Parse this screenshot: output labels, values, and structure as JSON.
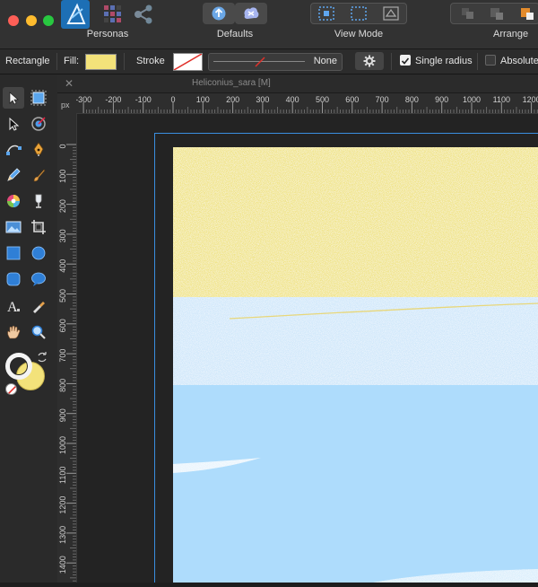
{
  "toolbar": {
    "personas_label": "Personas",
    "defaults_label": "Defaults",
    "view_mode_label": "View Mode",
    "arrange_label": "Arrange"
  },
  "context": {
    "tool_name": "Rectangle",
    "fill_label": "Fill:",
    "stroke_label": "Stroke",
    "stroke_value": "None",
    "single_radius_label": "Single radius",
    "single_radius_checked": true,
    "absolute_label": "Absolute",
    "fill_color": "#f3e27a"
  },
  "document": {
    "tab_title": "Heliconius_sara [M]",
    "ruler_unit": "px",
    "h_ticks": [
      "-300",
      "-200",
      "-100",
      "0",
      "100",
      "200",
      "300",
      "400",
      "500",
      "600",
      "700",
      "800",
      "900",
      "1000",
      "1100",
      "1200"
    ],
    "v_ticks": [
      "0",
      "100",
      "200",
      "300",
      "400",
      "500",
      "600",
      "700",
      "800",
      "900",
      "1000",
      "1100",
      "1200",
      "1300",
      "1400"
    ]
  },
  "colors": {
    "yellow_band": "#efe27c",
    "pale_blue_band": "#cde6fa",
    "blue_band": "#aedcfc",
    "selection": "#3a8fe0"
  },
  "icons": {
    "persona": "affinity-designer-persona-icon",
    "pixel_persona": "pixel-persona-icon",
    "export_persona": "export-persona-icon"
  }
}
